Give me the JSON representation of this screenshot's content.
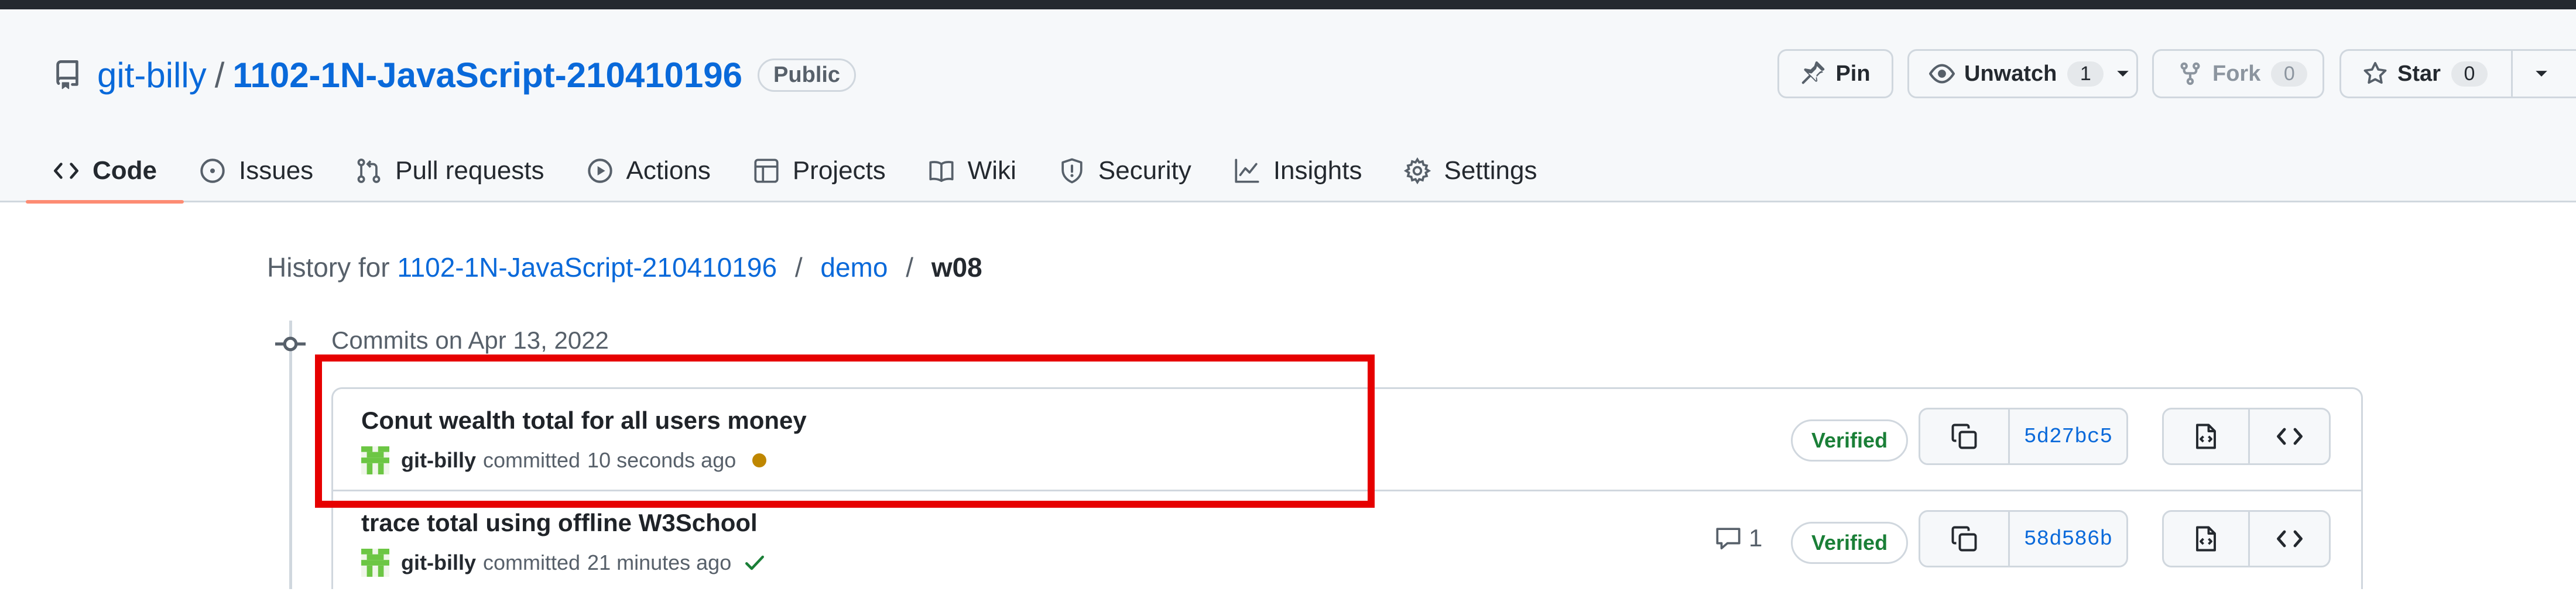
{
  "repo": {
    "owner": "git-billy",
    "separator": "/",
    "name": "1102-1N-JavaScript-210410196",
    "visibility": "Public"
  },
  "header_actions": {
    "pin": "Pin",
    "unwatch": "Unwatch",
    "unwatch_count": "1",
    "fork": "Fork",
    "fork_count": "0",
    "star": "Star",
    "star_count": "0"
  },
  "tabs": [
    {
      "label": "Code",
      "icon": "code-icon",
      "active": true
    },
    {
      "label": "Issues",
      "icon": "issue-icon"
    },
    {
      "label": "Pull requests",
      "icon": "pull-request-icon"
    },
    {
      "label": "Actions",
      "icon": "play-icon"
    },
    {
      "label": "Projects",
      "icon": "table-icon"
    },
    {
      "label": "Wiki",
      "icon": "book-icon"
    },
    {
      "label": "Security",
      "icon": "shield-icon"
    },
    {
      "label": "Insights",
      "icon": "graph-icon"
    },
    {
      "label": "Settings",
      "icon": "gear-icon"
    }
  ],
  "breadcrumb": {
    "prefix": "History for",
    "repo": "1102-1N-JavaScript-210410196",
    "folder": "demo",
    "current": "w08",
    "separator": "/"
  },
  "commits_date": "Commits on Apr 13, 2022",
  "commits": [
    {
      "title": "Conut wealth total for all users money",
      "author": "git-billy",
      "action": "committed",
      "time": "10 seconds ago",
      "status": "pending",
      "verified": "Verified",
      "sha": "5d27bc5"
    },
    {
      "title": "trace total using offline W3School",
      "author": "git-billy",
      "action": "committed",
      "time": "21 minutes ago",
      "status": "success",
      "comments": "1",
      "verified": "Verified",
      "sha": "58d586b"
    }
  ],
  "colors": {
    "link": "#0969da",
    "verified": "#1a7f37",
    "pending": "#bf8700",
    "highlight": "#e60000",
    "active_tab": "#fd8c73"
  }
}
